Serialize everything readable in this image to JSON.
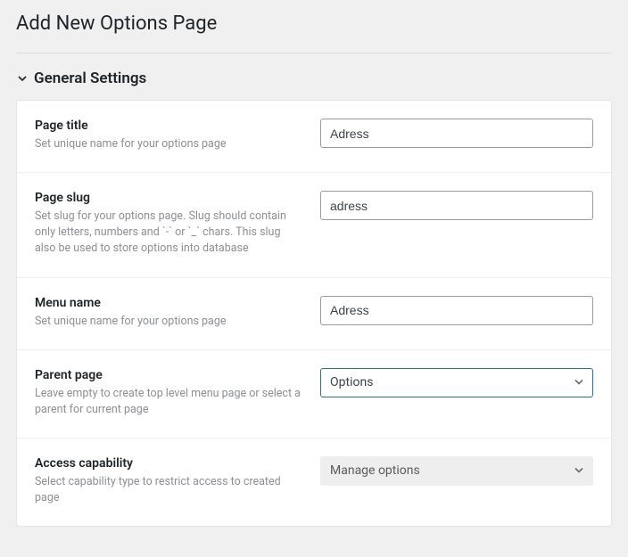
{
  "header": {
    "title": "Add New Options Page"
  },
  "section": {
    "title": "General Settings"
  },
  "fields": {
    "page_title": {
      "label": "Page title",
      "desc": "Set unique name for your options page",
      "value": "Adress"
    },
    "page_slug": {
      "label": "Page slug",
      "desc": "Set slug for your options page. Slug should contain only letters, numbers and `-` or `_` chars. This slug also be used to store options into database",
      "value": "adress"
    },
    "menu_name": {
      "label": "Menu name",
      "desc": "Set unique name for your options page",
      "value": "Adress"
    },
    "parent_page": {
      "label": "Parent page",
      "desc": "Leave empty to create top level menu page or select a parent for current page",
      "value": "Options"
    },
    "access_capability": {
      "label": "Access capability",
      "desc": "Select capability type to restrict access to created page",
      "value": "Manage options"
    }
  }
}
